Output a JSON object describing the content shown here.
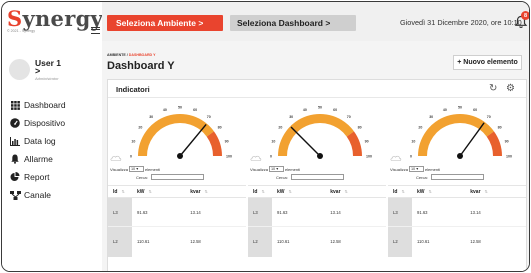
{
  "sidebar": {
    "logo_first": "S",
    "logo_rest": "ynergy",
    "copyright": "© 2021 - Synergy",
    "user_name": "User 1",
    "user_chevron": ">",
    "user_role": "Administrator",
    "items": [
      {
        "label": "Dashboard",
        "icon": "grid-icon"
      },
      {
        "label": "Dispositivo",
        "icon": "gauge-icon"
      },
      {
        "label": "Data log",
        "icon": "chart-icon"
      },
      {
        "label": "Allarme",
        "icon": "bell-icon"
      },
      {
        "label": "Report",
        "icon": "pie-icon"
      },
      {
        "label": "Canale",
        "icon": "network-icon"
      }
    ]
  },
  "topbar": {
    "ambiente_label": "Seleziona Ambiente  >",
    "dashboard_label": "Seleziona Dashboard  >",
    "datetime": "Giovedì 31 Dicembre 2020, ore 10:10",
    "badge_count": "8"
  },
  "main": {
    "breadcrumb_root": "AMBIENTE",
    "breadcrumb_current": "DASHBOARD Y",
    "title": "Dashboard Y",
    "new_button": "+ Nuovo elemento",
    "panel_title": "Indicatori"
  },
  "gauge_ticks": [
    "0",
    "10",
    "20",
    "30",
    "40",
    "50",
    "60",
    "70",
    "80",
    "90",
    "100"
  ],
  "widgets": [
    {
      "needle_value": 72,
      "show_label": "Visualizza",
      "show_value": "10",
      "elements_label": "elementi",
      "search_label": "Cerca:",
      "headers": [
        "Id",
        "kW",
        "kvar"
      ],
      "rows": [
        [
          "L3",
          "91.63",
          "13.14"
        ],
        [
          "L2",
          "110.61",
          "12.58"
        ]
      ]
    },
    {
      "needle_value": 25,
      "show_label": "Visualizza",
      "show_value": "10",
      "elements_label": "elementi",
      "search_label": "Cerca:",
      "headers": [
        "Id",
        "kW",
        "kvar"
      ],
      "rows": [
        [
          "L3",
          "91.63",
          "13.14"
        ],
        [
          "L2",
          "110.61",
          "12.58"
        ]
      ]
    },
    {
      "needle_value": 70,
      "show_label": "Visualizza",
      "show_value": "10",
      "elements_label": "elementi",
      "search_label": "Cerca:",
      "headers": [
        "Id",
        "kW",
        "kvar"
      ],
      "rows": [
        [
          "L3",
          "91.63",
          "13.14"
        ],
        [
          "L2",
          "110.61",
          "12.58"
        ]
      ]
    }
  ],
  "colors": {
    "accent": "#e9442e",
    "gauge_orange": "#f2a130",
    "gauge_red": "#e8602d"
  }
}
